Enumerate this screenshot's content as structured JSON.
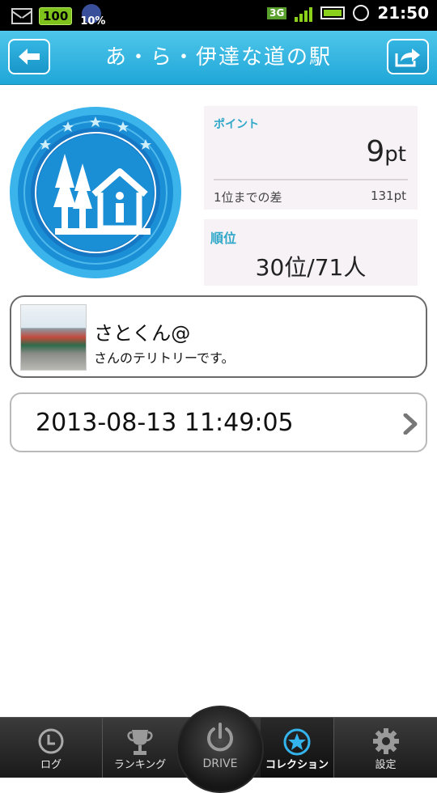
{
  "status_bar": {
    "battery_badge": "100",
    "weather_percent": "10%",
    "network": "3G",
    "time": "21:50"
  },
  "header": {
    "title": "あ・ら・伊達な道の駅"
  },
  "points": {
    "label": "ポイント",
    "value": "9",
    "unit": "pt",
    "gap_label": "1位までの差",
    "gap_value": "131pt"
  },
  "rank": {
    "label": "順位",
    "value": "30位/71人"
  },
  "owner": {
    "name": "さとくん@",
    "subtitle": "さんのテリトリーです。"
  },
  "visit": {
    "datetime": "2013-08-13 11:49:05"
  },
  "nav": {
    "log": "ログ",
    "ranking": "ランキング",
    "drive": "DRIVE",
    "collection": "コレクション",
    "settings": "設定"
  },
  "colors": {
    "accent": "#1fa7d8",
    "badge_blue": "#1b8fd6",
    "label_teal": "#31a8c9"
  }
}
